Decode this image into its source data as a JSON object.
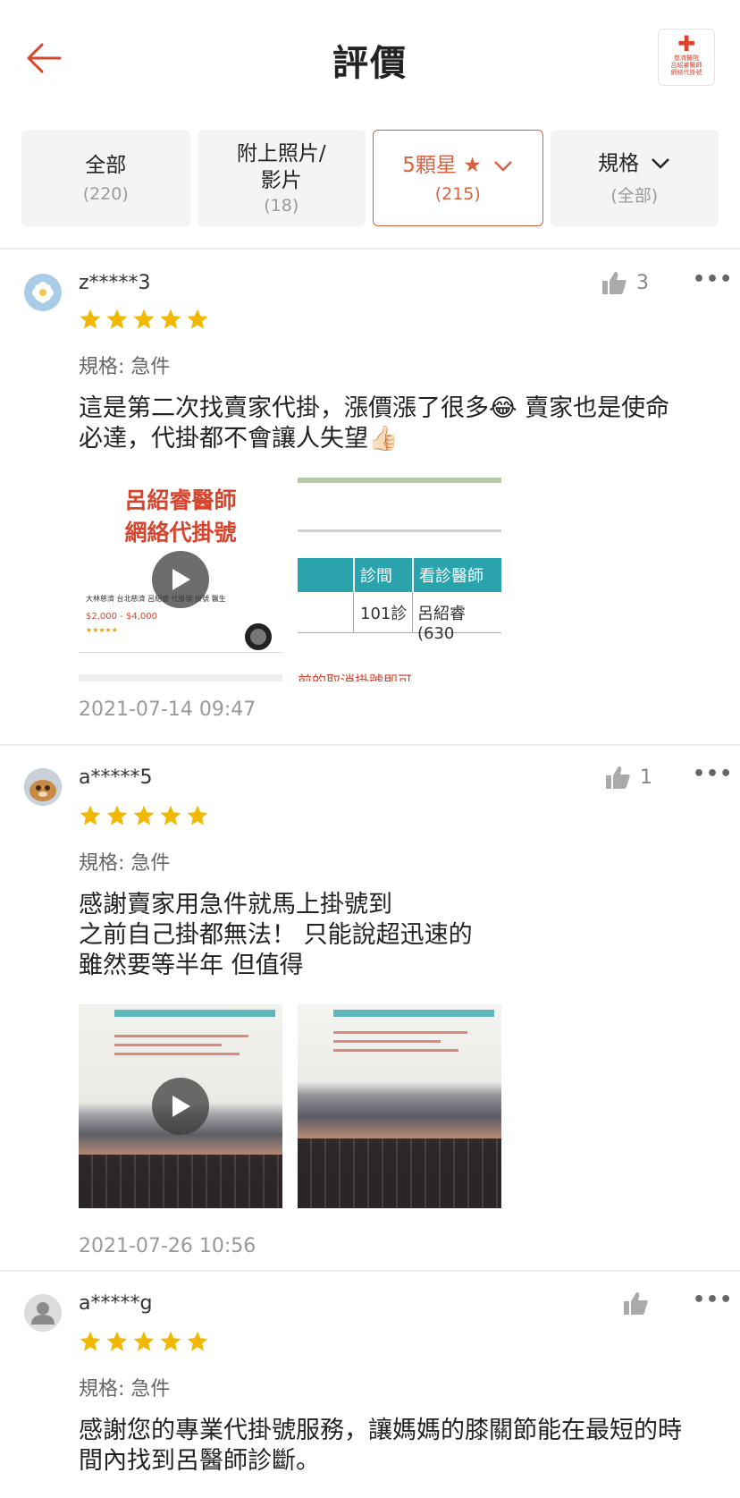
{
  "header": {
    "title": "評價",
    "shop_logo_text": [
      "慈濟醫院",
      "呂紹睿醫師",
      "網絡代掛號"
    ]
  },
  "filters": [
    {
      "label": "全部",
      "count": "(220)",
      "active": false
    },
    {
      "label": "附上照片/\n影片",
      "count": "(18)",
      "active": false
    },
    {
      "label": "5顆星 ★",
      "count": "(215)",
      "active": true
    },
    {
      "label": "規格",
      "count": "(全部)",
      "active": false
    }
  ],
  "colors": {
    "accent": "#d9613f",
    "star": "#f0b800"
  },
  "reviews": [
    {
      "username": "z*****3",
      "likes": "3",
      "rating": 5,
      "spec": "規格: 急件",
      "text": "這是第二次找賣家代掛，漲價漲了很多😂 賣家也是使命\n必達，代掛都不會讓人失望👍🏻",
      "media": {
        "thumb1_title": "呂紹睿醫師\n網絡代掛號",
        "thumb1_product": "大林慈濟 台北慈濟 呂紹睿 代掛號 掛號 醫生",
        "thumb1_price": "$2,000 - $4,000",
        "thumb2_headers": [
          "診間",
          "看診醫師"
        ],
        "thumb2_cells": [
          "101診",
          "呂紹睿(630"
        ],
        "thumb2_footer": "前的取消掛號即可。"
      },
      "date": "2021-07-14 09:47"
    },
    {
      "username": "a*****5",
      "likes": "1",
      "rating": 5,
      "spec": "規格: 急件",
      "text": "感謝賣家用急件就馬上掛號到\n之前自己掛都無法！ 只能說超迅速的\n雖然要等半年 但值得",
      "date": "2021-07-26 10:56"
    },
    {
      "username": "a*****g",
      "likes": "",
      "rating": 5,
      "spec": "規格: 急件",
      "text": "感謝您的專業代掛號服務，讓媽媽的膝關節能在最短的時\n間內找到呂醫師診斷。"
    }
  ]
}
